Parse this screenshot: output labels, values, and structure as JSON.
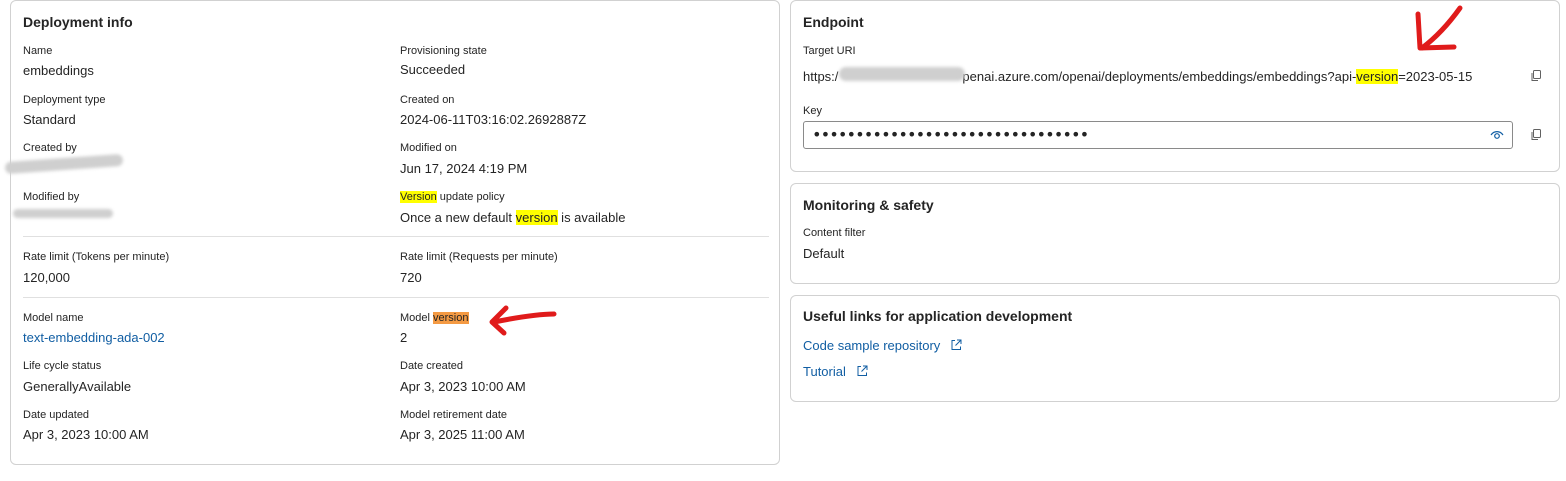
{
  "deployment_info": {
    "title": "Deployment info",
    "name": {
      "label": "Name",
      "value": "embeddings"
    },
    "provisioning_state": {
      "label": "Provisioning state",
      "value": "Succeeded"
    },
    "deployment_type": {
      "label": "Deployment type",
      "value": "Standard"
    },
    "created_on": {
      "label": "Created on",
      "value": "2024-06-11T03:16:02.2692887Z"
    },
    "created_by": {
      "label": "Created by"
    },
    "modified_on": {
      "label": "Modified on",
      "value": "Jun 17, 2024 4:19 PM"
    },
    "modified_by": {
      "label": "Modified by"
    },
    "version_update_policy": {
      "label_highlight": "Version",
      "label_rest": " update policy",
      "value_pre": "Once a new default ",
      "value_highlight": "version",
      "value_post": " is available"
    },
    "rate_limit_tokens": {
      "label": "Rate limit (Tokens per minute)",
      "value": "120,000"
    },
    "rate_limit_requests": {
      "label": "Rate limit (Requests per minute)",
      "value": "720"
    },
    "model_name": {
      "label": "Model name",
      "value": "text-embedding-ada-002"
    },
    "model_version": {
      "label_pre": "Model ",
      "label_highlight": "version",
      "value": "2"
    },
    "life_cycle_status": {
      "label": "Life cycle status",
      "value": "GenerallyAvailable"
    },
    "date_created": {
      "label": "Date created",
      "value": "Apr 3, 2023 10:00 AM"
    },
    "date_updated": {
      "label": "Date updated",
      "value": "Apr 3, 2023 10:00 AM"
    },
    "model_retirement_date": {
      "label": "Model retirement date",
      "value": "Apr 3, 2025 11:00 AM"
    }
  },
  "endpoint": {
    "title": "Endpoint",
    "target_uri": {
      "label": "Target URI",
      "prefix": "https:/",
      "middle": "penai.azure.com/openai/deployments/embeddings/embeddings?api-",
      "highlight": "version",
      "suffix": "=2023-05-15"
    },
    "key": {
      "label": "Key",
      "masked": "••••••••••••••••••••••••••••••••"
    }
  },
  "monitoring": {
    "title": "Monitoring & safety",
    "content_filter": {
      "label": "Content filter",
      "value": "Default"
    }
  },
  "useful_links": {
    "title": "Useful links for application development",
    "links": [
      "Code sample repository",
      "Tutorial"
    ]
  },
  "colors": {
    "highlight_yellow": "#ffff00",
    "highlight_orange": "#f49a43",
    "link": "#115ea3",
    "annotation_red": "#e01b1b"
  },
  "icons": [
    "copy-icon",
    "eye-icon",
    "external-link-icon",
    "annotation-arrow"
  ]
}
